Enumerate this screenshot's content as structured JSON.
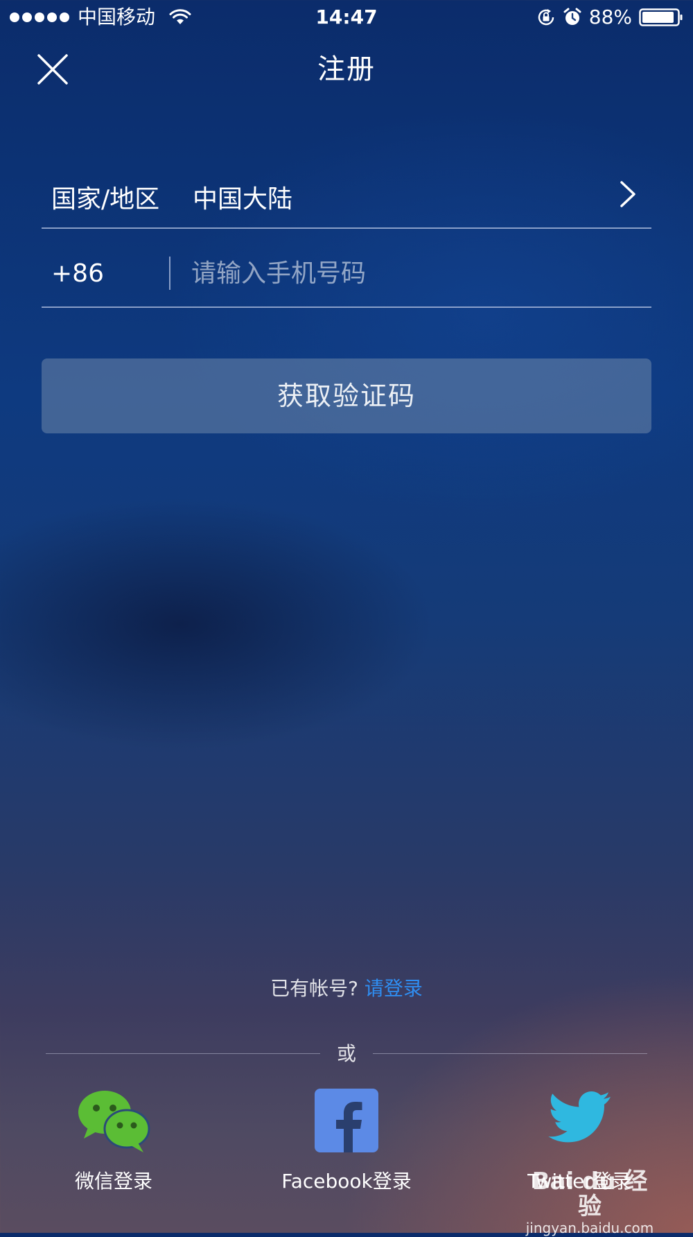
{
  "status_bar": {
    "carrier": "中国移动",
    "time": "14:47",
    "battery": "88%"
  },
  "header": {
    "title": "注册"
  },
  "form": {
    "country_label": "国家/地区",
    "country_value": "中国大陆",
    "country_code": "+86",
    "phone_placeholder": "请输入手机号码",
    "get_code_button": "获取验证码"
  },
  "login_hint": {
    "text": "已有帐号?",
    "link": "请登录"
  },
  "divider": {
    "text": "或"
  },
  "social": [
    {
      "label": "微信登录",
      "icon": "wechat-icon"
    },
    {
      "label": "Facebook登录",
      "icon": "facebook-icon"
    },
    {
      "label": "Twitter登录",
      "icon": "twitter-icon"
    }
  ],
  "watermark": {
    "logo": "Bai du 经验",
    "url": "jingyan.baidu.com"
  },
  "colors": {
    "link": "#2f8ef2",
    "wechat_green": "#5bbd35",
    "facebook_blue": "#5c8ae6",
    "twitter_blue": "#2fb8e0"
  }
}
